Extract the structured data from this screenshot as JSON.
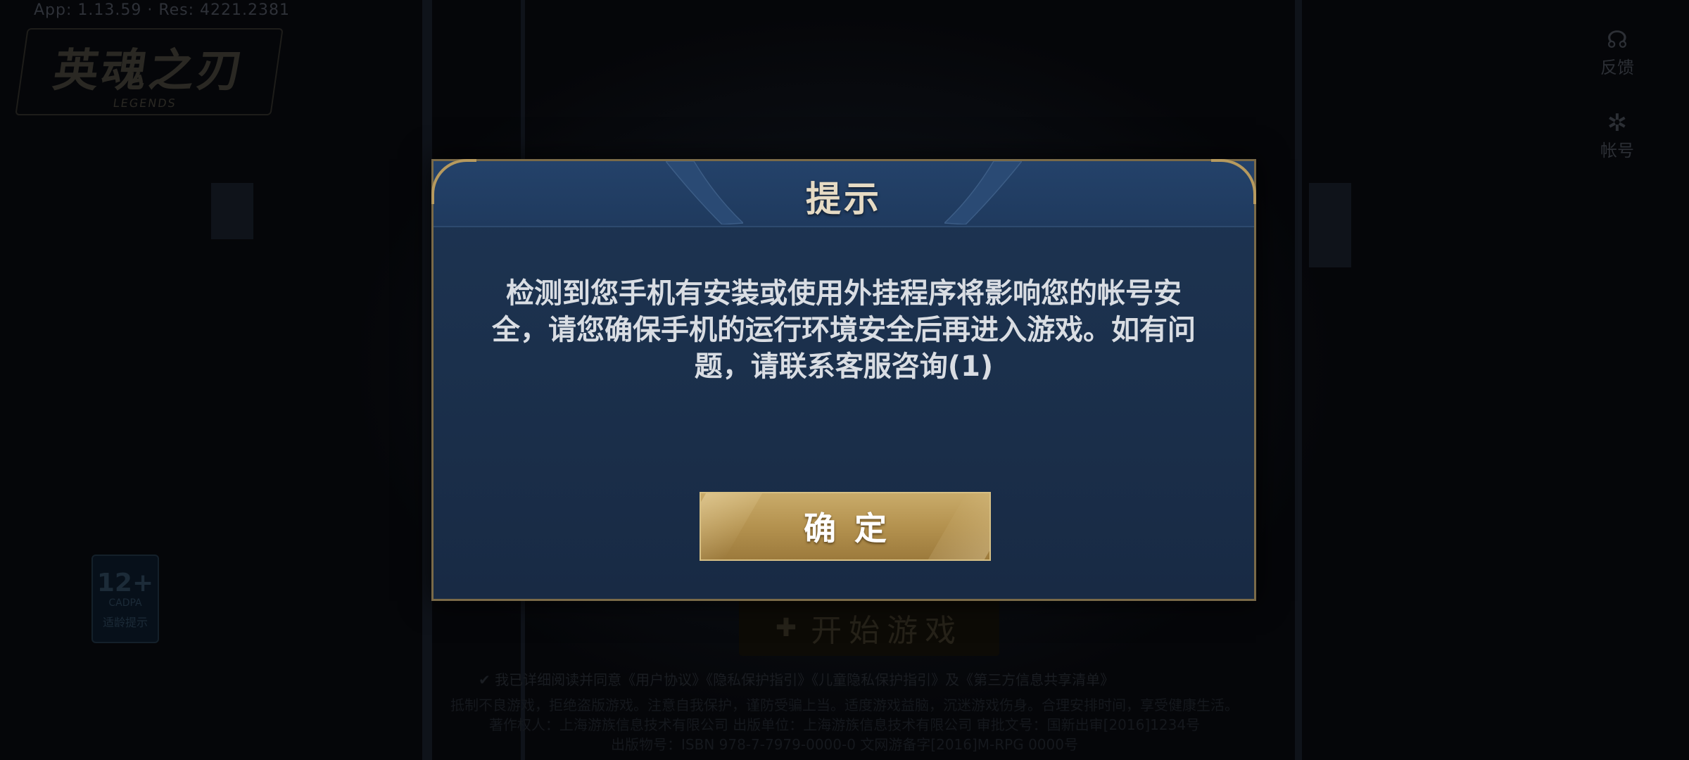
{
  "background": {
    "version_text": "App: 1.13.59 · Res: 4221.2381",
    "logo": {
      "title": "英魂之刃",
      "subtitle": "LEGENDS"
    },
    "side_buttons": [
      {
        "icon": "headset-icon",
        "glyph": "☊",
        "label": "反馈"
      },
      {
        "icon": "gear-icon",
        "glyph": "✲",
        "label": "帐号"
      }
    ],
    "age_badge": {
      "rating": "12+",
      "small": "CADPA",
      "label": "适龄提示"
    },
    "start_button": {
      "icon": "gamepad-icon",
      "glyph": "✚",
      "label": "开始游戏"
    },
    "agreement_text": "我已详细阅读并同意《用户协议》《隐私保护指引》《儿童隐私保护指引》及《第三方信息共享清单》",
    "fine_print": [
      "抵制不良游戏，拒绝盗版游戏。注意自我保护，谨防受骗上当。适度游戏益脑，沉迷游戏伤身。合理安排时间，享受健康生活。",
      "著作权人：上海游族信息技术有限公司 出版单位：上海游族信息技术有限公司 审批文号：国新出审[2016]1234号",
      "出版物号：ISBN 978-7-7979-0000-0 文网游备字[2016]M-RPG 0000号"
    ]
  },
  "dialog": {
    "title": "提示",
    "message": "检测到您手机有安装或使用外挂程序将影响您的帐号安全，请您确保手机的运行环境安全后再进入游戏。如有问题，请联系客服咨询(1)",
    "confirm_label": "确定"
  },
  "colors": {
    "dialog_bg": "#1b304c",
    "dialog_border": "#7a6a48",
    "gold_button": "#b4924f",
    "title_text": "#e6dbc4",
    "message_text": "#d9dde3"
  }
}
